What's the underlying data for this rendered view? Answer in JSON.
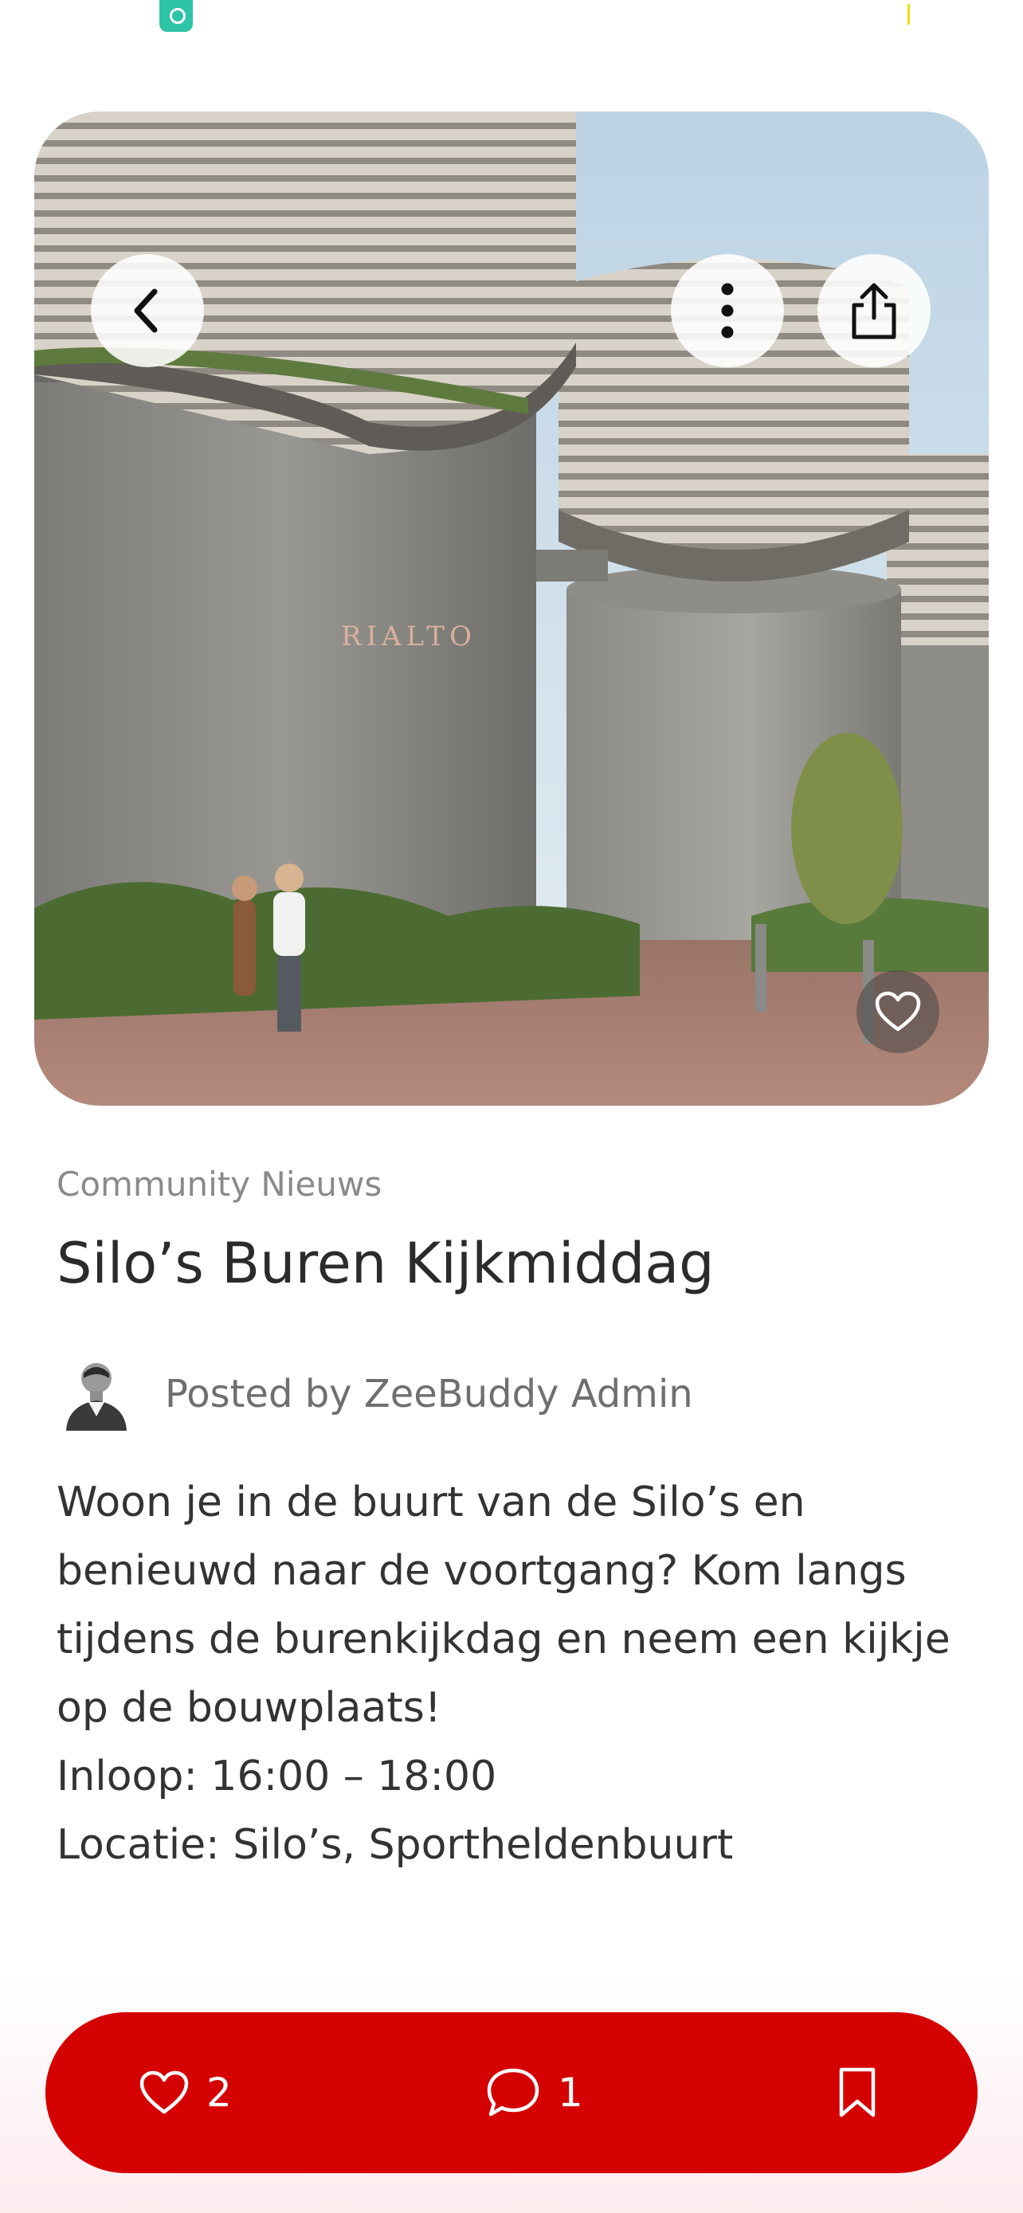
{
  "post": {
    "category": "Community Nieuws",
    "title": "Silo’s Buren Kijkmiddag",
    "author": "Posted by ZeeBuddy Admin",
    "body": [
      "Woon je in de buurt van de Silo’s en",
      "benieuwd naar de voortgang? Kom langs",
      "tijdens de burenkijkdag en neem een kijkje",
      "op de bouwplaats!",
      "Inloop: 16:00 – 18:00",
      "Locatie: Silo’s, Sportheldenbuurt"
    ],
    "hero_sign": "RIALTO"
  },
  "actions": {
    "likes": "2",
    "comments": "1"
  },
  "icons": {
    "back": "chevron-left-icon",
    "more": "more-vertical-icon",
    "share": "share-icon",
    "favorite": "heart-outline-icon",
    "like": "heart-outline-icon",
    "comment": "comment-icon",
    "bookmark": "bookmark-icon"
  },
  "colors": {
    "accent": "#d50000",
    "status_icon": "#2ec4a6"
  }
}
